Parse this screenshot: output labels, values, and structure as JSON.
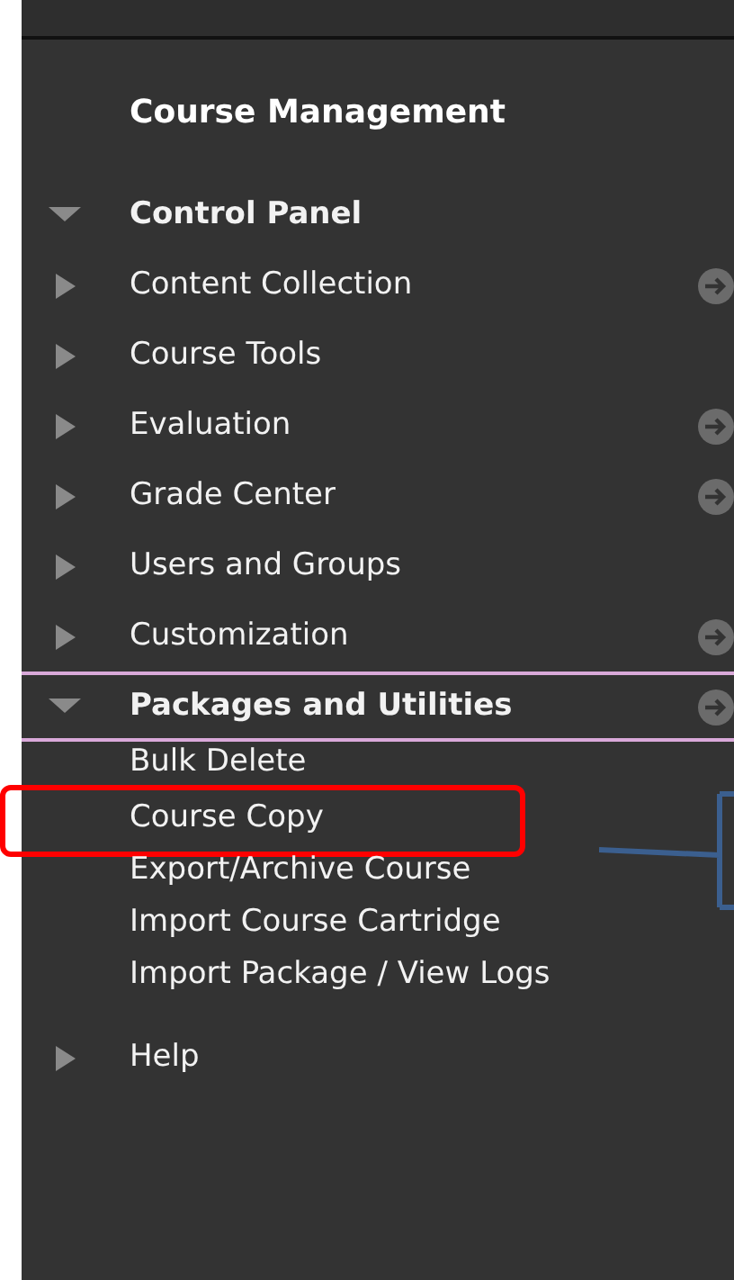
{
  "panel": {
    "title": "Course Management"
  },
  "menu": [
    {
      "label": "Control Panel",
      "expanded": true,
      "children": [
        {
          "label": "Content Collection",
          "expanded": false,
          "quick_link": true
        },
        {
          "label": "Course Tools",
          "expanded": false,
          "quick_link": false
        },
        {
          "label": "Evaluation",
          "expanded": false,
          "quick_link": true
        },
        {
          "label": "Grade Center",
          "expanded": false,
          "quick_link": true
        },
        {
          "label": "Users and Groups",
          "expanded": false,
          "quick_link": false
        },
        {
          "label": "Customization",
          "expanded": false,
          "quick_link": true
        },
        {
          "label": "Packages and Utilities",
          "expanded": true,
          "quick_link": true,
          "children": [
            {
              "label": "Bulk Delete",
              "highlighted": false
            },
            {
              "label": "Course Copy",
              "highlighted": true
            },
            {
              "label": "Export/Archive Course",
              "highlighted": false
            },
            {
              "label": "Import Course Cartridge",
              "highlighted": false
            },
            {
              "label": "Import Package / View Logs",
              "highlighted": false
            }
          ]
        }
      ]
    },
    {
      "label": "Help",
      "expanded": false
    }
  ]
}
